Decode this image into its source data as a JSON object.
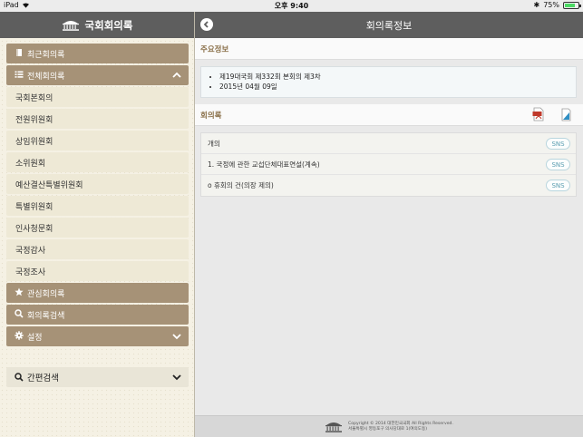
{
  "status": {
    "device": "iPad",
    "time": "오후 9:40",
    "battery": "75%",
    "battery_level": 0.75
  },
  "sidebar": {
    "title": "국회회의록",
    "items": [
      {
        "label": "최근회의록",
        "style": "brown",
        "icon": "book-icon"
      },
      {
        "label": "전체회의록",
        "style": "brown",
        "icon": "list-icon",
        "chevron": "up"
      },
      {
        "label": "국회본회의",
        "style": "light"
      },
      {
        "label": "전원위원회",
        "style": "light"
      },
      {
        "label": "상임위원회",
        "style": "light"
      },
      {
        "label": "소위원회",
        "style": "light"
      },
      {
        "label": "예산결산특별위원회",
        "style": "light"
      },
      {
        "label": "특별위원회",
        "style": "light"
      },
      {
        "label": "인사청문회",
        "style": "light"
      },
      {
        "label": "국정감사",
        "style": "light"
      },
      {
        "label": "국정조사",
        "style": "light"
      },
      {
        "label": "관심회의록",
        "style": "brown",
        "icon": "star-icon"
      },
      {
        "label": "회의록검색",
        "style": "brown",
        "icon": "search-icon"
      },
      {
        "label": "설정",
        "style": "brown",
        "icon": "gear-icon",
        "chevron": "down"
      }
    ],
    "quick_search": "간편검색"
  },
  "main": {
    "title": "회의록정보",
    "section_main": "주요정보",
    "info": [
      "제19대국회 제332회 본회의 제3차",
      "2015년 04월 09일"
    ],
    "section_minutes": "회의록",
    "sns_label": "SNS",
    "minutes": [
      "개의",
      "1. 국정에 관한 교섭단체대표연설(계속)",
      "o 휴회의 건(의장 제의)"
    ],
    "footer": {
      "copyright": "Copyright © 2014 대한민국국회 All Rights Reserved.",
      "address": "서울특별시 영등포구 의사당대로 1(여의도동)"
    }
  },
  "colors": {
    "header": "#5e5e5e",
    "brown": "#a69277",
    "accent_text": "#8a7049",
    "sns": "#5b9eb1"
  }
}
